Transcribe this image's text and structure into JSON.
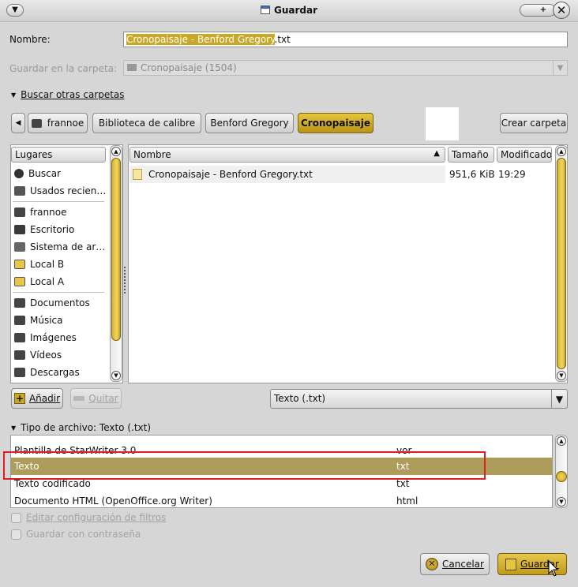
{
  "window": {
    "title": "Guardar"
  },
  "name_field": {
    "label": "Nombre:",
    "value_selected": "Cronopaisaje - Benford Gregory",
    "value_rest": ".txt"
  },
  "save_in": {
    "label": "Guardar en la carpeta:",
    "value": "Cronopaisaje (1504)"
  },
  "browse_expander": {
    "label": "Buscar otras carpetas"
  },
  "path_bar": {
    "back_icon": "left-arrow-icon",
    "segments": [
      "frannoe",
      "Biblioteca de calibre",
      "Benford Gregory",
      "Cronopaisaje"
    ],
    "create_folder": "Crear carpeta"
  },
  "places": {
    "header": "Lugares",
    "items": [
      {
        "label": "Buscar",
        "icon": "search-icon"
      },
      {
        "label": "Usados recien…",
        "icon": "recent-icon"
      },
      {
        "label": "frannoe",
        "icon": "home-icon"
      },
      {
        "label": "Escritorio",
        "icon": "desktop-icon"
      },
      {
        "label": "Sistema de ar…",
        "icon": "filesystem-icon"
      },
      {
        "label": "Local B",
        "icon": "drive-b-icon"
      },
      {
        "label": "Local A",
        "icon": "drive-a-icon"
      },
      {
        "label": "Documentos",
        "icon": "documents-icon"
      },
      {
        "label": "Música",
        "icon": "music-icon"
      },
      {
        "label": "Imágenes",
        "icon": "pictures-icon"
      },
      {
        "label": "Vídeos",
        "icon": "videos-icon"
      },
      {
        "label": "Descargas",
        "icon": "downloads-icon"
      }
    ],
    "add_button": "Añadir",
    "remove_button": "Quitar"
  },
  "files": {
    "columns": {
      "name": "Nombre",
      "size": "Tamaño",
      "modified": "Modificado"
    },
    "rows": [
      {
        "name": "Cronopaisaje - Benford Gregory.txt",
        "size": "951,6 KiB",
        "modified": "19:29"
      }
    ]
  },
  "filter_combo": {
    "value": "Texto (.txt)"
  },
  "filetype_expander": {
    "label": "Tipo de archivo: Texto (.txt)"
  },
  "filetypes": [
    {
      "name": "Plantilla de StarWriter 3.0",
      "ext": "vor"
    },
    {
      "name": "Texto",
      "ext": "txt"
    },
    {
      "name": "Texto codificado",
      "ext": "txt"
    },
    {
      "name": "Documento HTML (OpenOffice.org Writer)",
      "ext": "html"
    }
  ],
  "options": {
    "edit_filter": "Editar configuración de filtros",
    "password": "Guardar con contraseña"
  },
  "actions": {
    "cancel": "Cancelar",
    "save": "Guardar"
  },
  "colors": {
    "accent": "#c9a825",
    "selection_row": "#ad9c5a",
    "annotation_box": "#e02020"
  }
}
